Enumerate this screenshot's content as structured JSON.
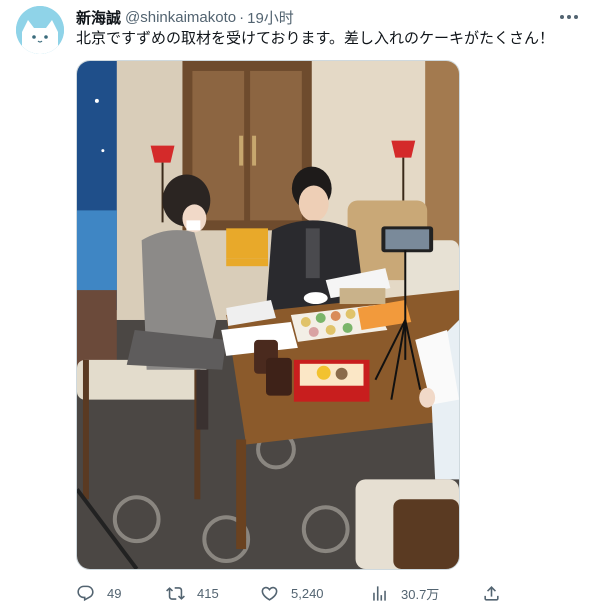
{
  "author": {
    "display_name": "新海誠",
    "handle": "@shinkaimakoto",
    "separator": "·",
    "time": "19小时",
    "avatar_icon": "cat-avatar-icon"
  },
  "tweet": {
    "text": "北京ですずめの取材を受けております。差し入れのケーキがたくさん！"
  },
  "media": {
    "type": "photo",
    "description_icon": "interview-photo"
  },
  "actions": {
    "reply": {
      "icon": "reply-icon",
      "count": "49"
    },
    "retweet": {
      "icon": "retweet-icon",
      "count": "415"
    },
    "like": {
      "icon": "heart-icon",
      "count": "5,240"
    },
    "views": {
      "icon": "views-chart-icon",
      "count": "30.7万"
    },
    "share": {
      "icon": "share-icon"
    }
  },
  "colors": {
    "text_primary": "#0f1419",
    "text_secondary": "#536471",
    "avatar_bg": "#8fd3e8",
    "border": "#cfd9de"
  }
}
